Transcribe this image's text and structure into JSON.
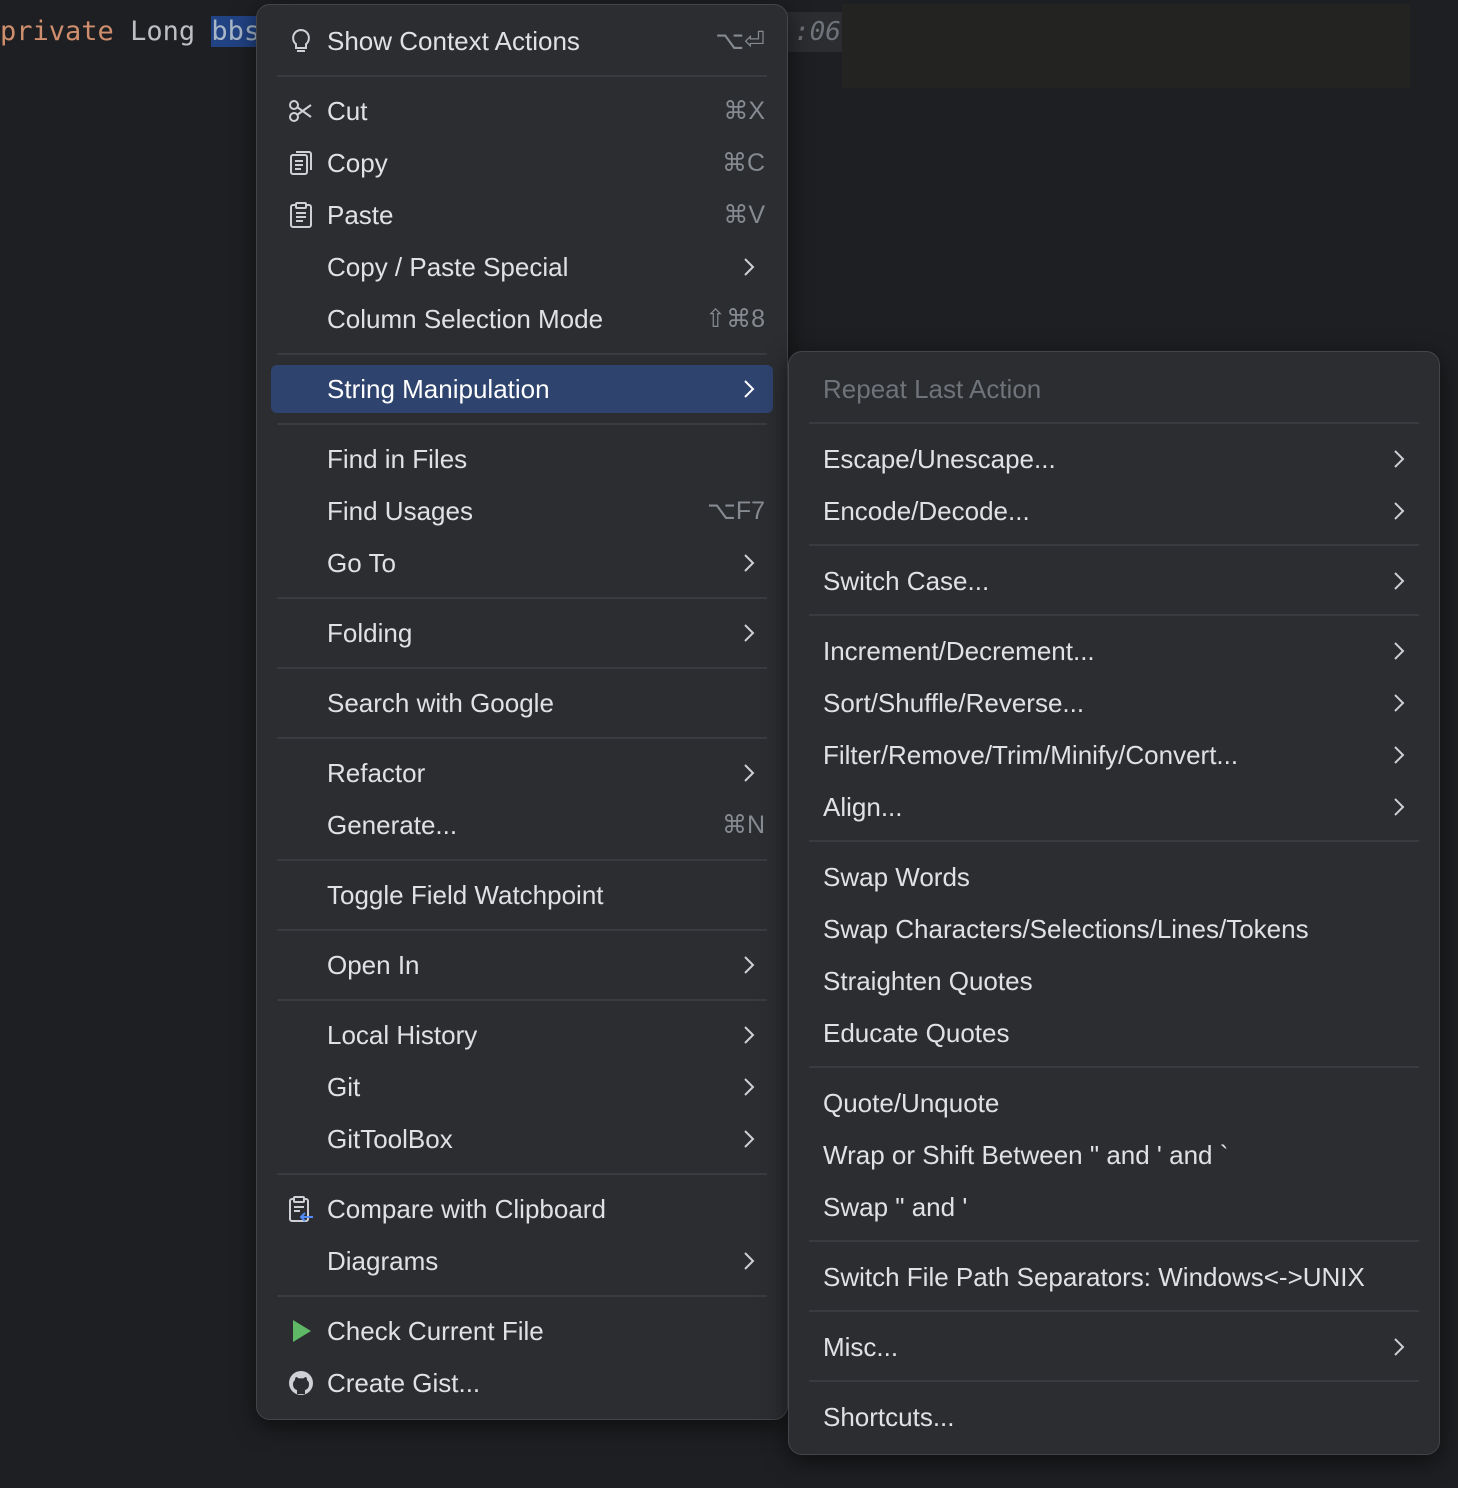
{
  "editor": {
    "keyword": "private",
    "type": "Long",
    "selected": "bbs",
    "tail_text": ":06"
  },
  "context_menu": {
    "show_context_actions": {
      "label": "Show Context Actions",
      "shortcut": "⌥⏎"
    },
    "cut": {
      "label": "Cut",
      "shortcut": "⌘X"
    },
    "copy": {
      "label": "Copy",
      "shortcut": "⌘C"
    },
    "paste": {
      "label": "Paste",
      "shortcut": "⌘V"
    },
    "copy_paste_special": {
      "label": "Copy / Paste Special"
    },
    "column_selection_mode": {
      "label": "Column Selection Mode",
      "shortcut": "⇧⌘8"
    },
    "string_manipulation": {
      "label": "String Manipulation"
    },
    "find_in_files": {
      "label": "Find in Files"
    },
    "find_usages": {
      "label": "Find Usages",
      "shortcut": "⌥F7"
    },
    "go_to": {
      "label": "Go To"
    },
    "folding": {
      "label": "Folding"
    },
    "search_with_google": {
      "label": "Search with Google"
    },
    "refactor": {
      "label": "Refactor"
    },
    "generate": {
      "label": "Generate...",
      "shortcut": "⌘N"
    },
    "toggle_field_watchpoint": {
      "label": "Toggle Field Watchpoint"
    },
    "open_in": {
      "label": "Open In"
    },
    "local_history": {
      "label": "Local History"
    },
    "git": {
      "label": "Git"
    },
    "gittoolbox": {
      "label": "GitToolBox"
    },
    "compare_with_clipboard": {
      "label": "Compare with Clipboard"
    },
    "diagrams": {
      "label": "Diagrams"
    },
    "check_current_file": {
      "label": "Check Current File"
    },
    "create_gist": {
      "label": "Create Gist..."
    }
  },
  "submenu": {
    "repeat_last_action": "Repeat Last Action",
    "escape_unescape": "Escape/Unescape...",
    "encode_decode": "Encode/Decode...",
    "switch_case": "Switch Case...",
    "increment_decrement": "Increment/Decrement...",
    "sort_shuffle_reverse": "Sort/Shuffle/Reverse...",
    "filter_remove": "Filter/Remove/Trim/Minify/Convert...",
    "align": "Align...",
    "swap_words": "Swap Words",
    "swap_characters": "Swap Characters/Selections/Lines/Tokens",
    "straighten_quotes": "Straighten Quotes",
    "educate_quotes": "Educate Quotes",
    "quote_unquote": "Quote/Unquote",
    "wrap_or_shift": "Wrap or Shift Between \" and ' and `",
    "swap_quotes": "Swap \" and '",
    "switch_file_path": "Switch File Path Separators: Windows<->UNIX",
    "misc": "Misc...",
    "shortcuts": "Shortcuts..."
  },
  "colors": {
    "background": "#1e1f22",
    "menu_bg": "#2b2d30",
    "highlight": "#2e436e",
    "run_icon": "#5fb865"
  }
}
